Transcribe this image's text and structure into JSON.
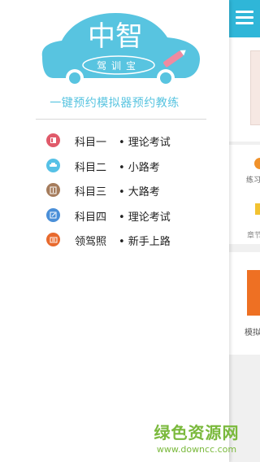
{
  "logo": {
    "title": "中智",
    "badge": "驾训宝"
  },
  "tagline": "一键预约模拟器预约教练",
  "menu": {
    "items": [
      {
        "label": "科目一",
        "desc": "• 理论考试",
        "icon": "book-icon",
        "color": "#e05a6a"
      },
      {
        "label": "科目二",
        "desc": "• 小路考",
        "icon": "car-icon",
        "color": "#56c1e6"
      },
      {
        "label": "科目三",
        "desc": "• 大路考",
        "icon": "road-icon",
        "color": "#a57c5c"
      },
      {
        "label": "科目四",
        "desc": "• 理论考试",
        "icon": "edit-icon",
        "color": "#4a8fd8"
      },
      {
        "label": "领驾照",
        "desc": "• 新手上路",
        "icon": "license-icon",
        "color": "#e86a2e"
      }
    ]
  },
  "main_peek": {
    "text1": "练习",
    "text2": "章节",
    "text3": "模拟"
  },
  "watermark": {
    "cn": "绿色资源网",
    "url": "www.downcc.com"
  },
  "colors": {
    "brand": "#58c4e0",
    "topbar": "#2fb6d8",
    "watermark": "#7ab93c"
  }
}
